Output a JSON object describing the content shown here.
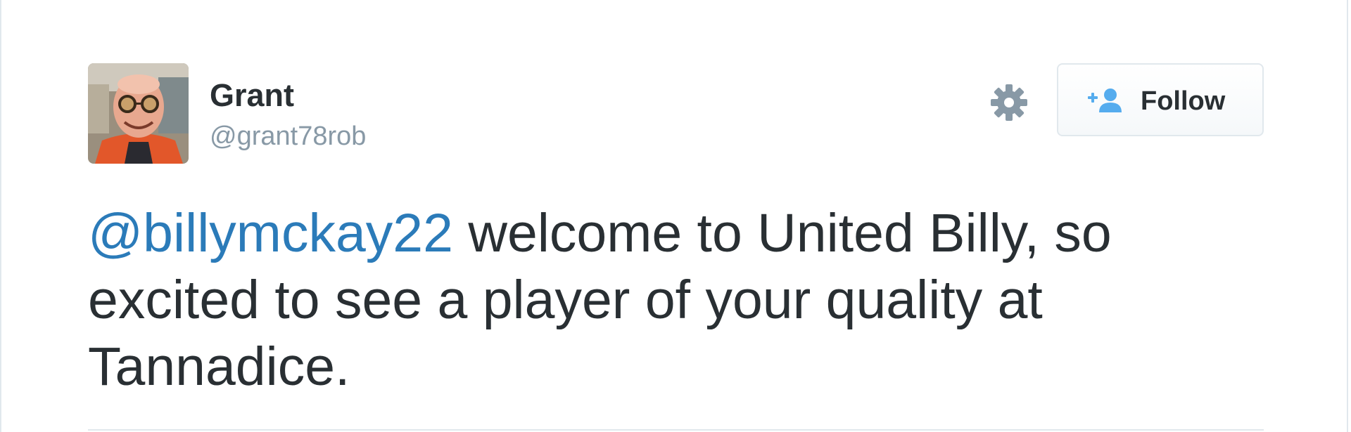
{
  "tweet": {
    "author": {
      "name": "Grant",
      "handle": "@grant78rob"
    },
    "follow_button": {
      "label": "Follow"
    },
    "icons": {
      "gear": "gear-icon",
      "follow": "follow-person-icon"
    },
    "text": {
      "mention": "@billymckay22",
      "body": " welcome to United Billy, so excited to see a player of your quality at Tannadice."
    }
  },
  "colors": {
    "mention": "#2b7bb9",
    "handle": "#8899a6",
    "follow_icon": "#55acee",
    "text": "#292f33",
    "border": "#e1e8ed"
  }
}
